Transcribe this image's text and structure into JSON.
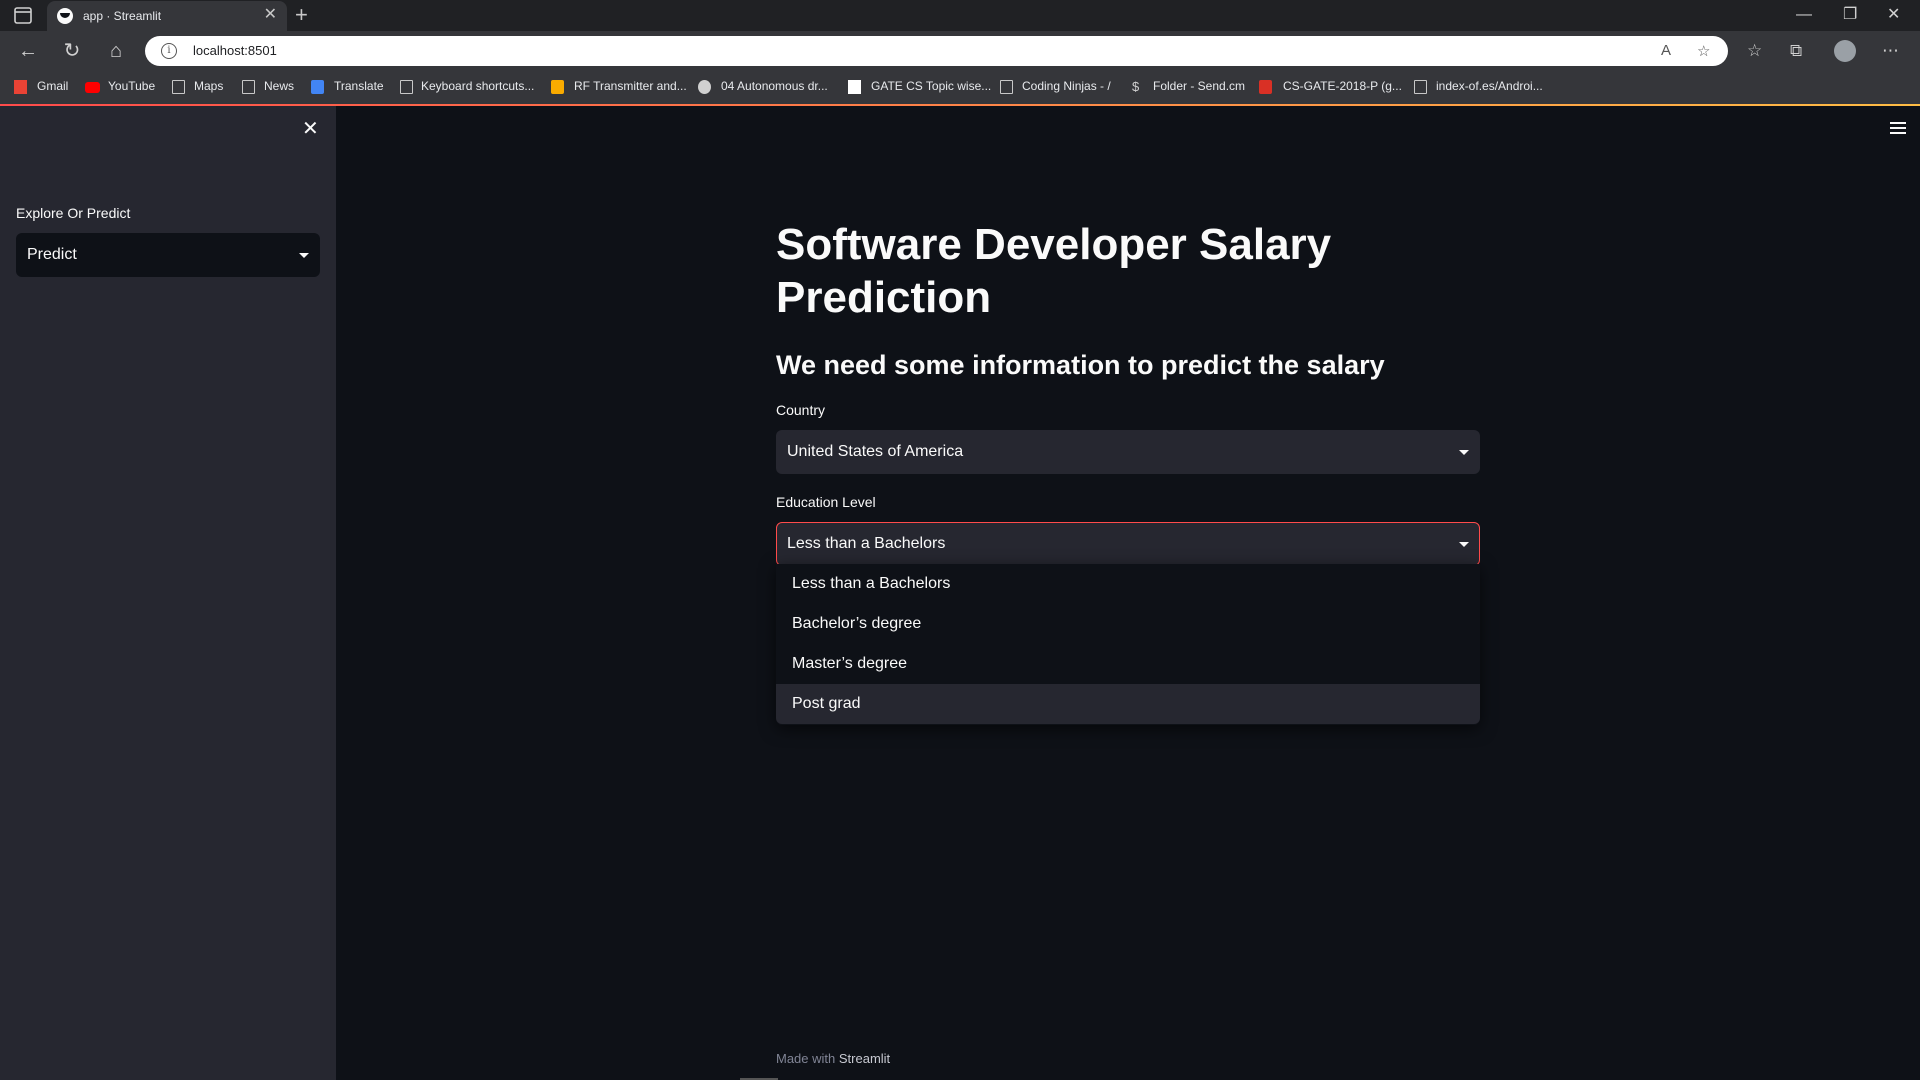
{
  "browser": {
    "tab_title": "app · Streamlit",
    "url": "localhost:8501",
    "bookmarks": [
      {
        "label": "Gmail",
        "icon": "gmail-icon"
      },
      {
        "label": "YouTube",
        "icon": "youtube-icon"
      },
      {
        "label": "Maps",
        "icon": "page-icon"
      },
      {
        "label": "News",
        "icon": "page-icon"
      },
      {
        "label": "Translate",
        "icon": "translate-icon"
      },
      {
        "label": "Keyboard shortcuts...",
        "icon": "page-icon"
      },
      {
        "label": "RF Transmitter and...",
        "icon": "rf-icon"
      },
      {
        "label": "04 Autonomous dr...",
        "icon": "github-icon"
      },
      {
        "label": "GATE CS Topic wise...",
        "icon": "gate-icon"
      },
      {
        "label": "Coding Ninjas - /",
        "icon": "page-icon"
      },
      {
        "label": "Folder - Send.cm",
        "icon": "send-icon"
      },
      {
        "label": "CS-GATE-2018-P (g...",
        "icon": "pdf-icon"
      },
      {
        "label": "index-of.es/Androi...",
        "icon": "page-icon"
      }
    ]
  },
  "sidebar": {
    "label": "Explore Or Predict",
    "selected": "Predict"
  },
  "main": {
    "title": "Software Developer Salary Prediction",
    "subheader": "We need some information to predict the salary",
    "country": {
      "label": "Country",
      "value": "United States of America"
    },
    "education": {
      "label": "Education Level",
      "value": "Less than a Bachelors",
      "options": [
        "Less than a Bachelors",
        "Bachelor’s degree",
        "Master’s degree",
        "Post grad"
      ],
      "hovered_option": "Post grad"
    },
    "footer": {
      "prefix": "Made with",
      "brand": "Streamlit"
    }
  },
  "colors": {
    "accent": "#ff4b4b",
    "background": "#0e1117",
    "sidebar_bg": "#262730",
    "text": "#fafafa"
  }
}
